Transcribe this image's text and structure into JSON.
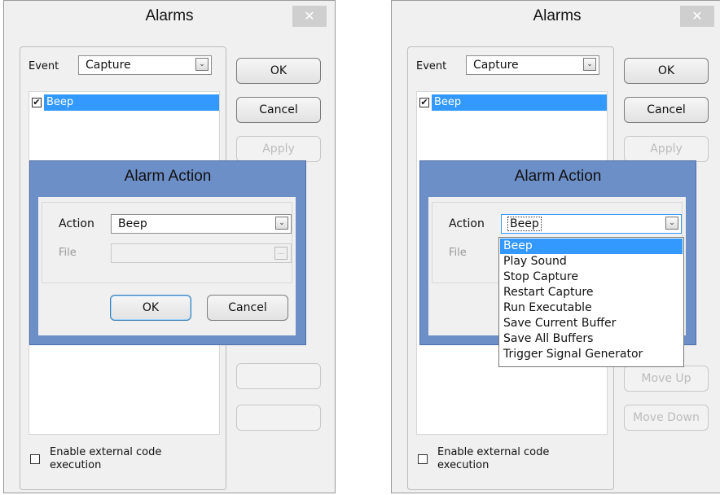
{
  "left": {
    "title": "Alarms",
    "close": "✕",
    "event_label": "Event",
    "event_value": "Capture",
    "alarm_item": "Beep",
    "buttons": {
      "ok": "OK",
      "cancel": "Cancel",
      "apply": "Apply"
    },
    "enable_label": "Enable external code execution",
    "dialog": {
      "title": "Alarm Action",
      "action_label": "Action",
      "action_value": "Beep",
      "file_label": "File",
      "ok": "OK",
      "cancel": "Cancel"
    }
  },
  "right": {
    "title": "Alarms",
    "close": "✕",
    "event_label": "Event",
    "event_value": "Capture",
    "alarm_item": "Beep",
    "buttons": {
      "ok": "OK",
      "cancel": "Cancel",
      "apply": "Apply",
      "move_up": "Move Up",
      "move_down": "Move Down"
    },
    "enable_label": "Enable external code execution",
    "dialog": {
      "title": "Alarm Action",
      "action_label": "Action",
      "action_value": "Beep",
      "file_label": "File"
    },
    "dropdown_options": [
      "Beep",
      "Play Sound",
      "Stop Capture",
      "Restart Capture",
      "Run Executable",
      "Save Current Buffer",
      "Save All Buffers",
      "Trigger Signal Generator"
    ],
    "dropdown_selected": "Beep"
  },
  "icons": {
    "combo_arrow": "⌄",
    "checkmark": "✔",
    "browse": "…"
  },
  "colors": {
    "selection": "#3399ff",
    "dialog_frame": "#6d8fc7",
    "window_bg": "#f0f0f0"
  }
}
